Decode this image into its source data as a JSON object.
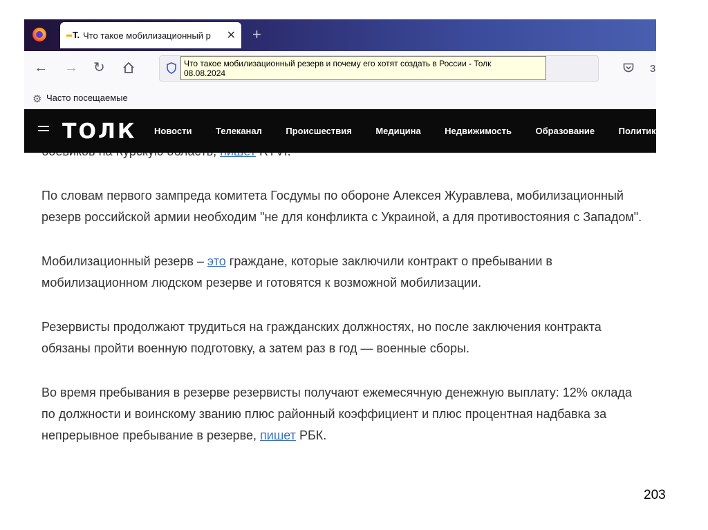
{
  "browser": {
    "tab_title": "Что такое мобилизационный р",
    "tab_favicon": "T.",
    "tooltip_line1": "Что такое мобилизационный резерв и почему его хотят создать в России - Толк",
    "tooltip_line2": "08.08.2024",
    "bookmark_label": "Часто посещаемые",
    "icons": [
      "firefox-logo",
      "close-icon",
      "new-tab-icon",
      "back-icon",
      "forward-icon",
      "reload-icon",
      "home-icon",
      "shield-icon",
      "pocket-icon",
      "gear-icon"
    ]
  },
  "site": {
    "logo": "ТОЛК",
    "menu": [
      "Новости",
      "Телеканал",
      "Происшествия",
      "Медицина",
      "Недвижимость",
      "Образование",
      "Политик"
    ]
  },
  "article": {
    "cut_line_before": "боевиков на Курскую область, ",
    "cut_line_link": "пишет",
    "cut_line_after": " RTVI.",
    "p1": "По словам первого зампреда комитета Госдумы по обороне Алексея Журавлева, мобилизационный резерв российской армии необходим \"не для конфликта с Украиной, а для противостояния с Западом\".",
    "p2_before": "Мобилизационный резерв – ",
    "p2_link": "это",
    "p2_after": " граждане, которые заключили контракт о пребывании в мобилизационном людском резерве и готовятся к возможной мобилизации.",
    "p3": "Резервисты продолжают трудиться на гражданских должностях, но после заключения контракта обязаны пройти военную подготовку, а затем раз в год — военные сборы.",
    "p4_before": "Во время пребывания в резерве резервисты получают ежемесячную денежную выплату: 12% оклада по должности и воинскому званию плюс районный коэффициент и плюс процентная надбавка за непрерывное пребывание в резерве, ",
    "p4_link": "пишет",
    "p4_after": " РБК."
  },
  "slide": {
    "page_number": "203"
  }
}
